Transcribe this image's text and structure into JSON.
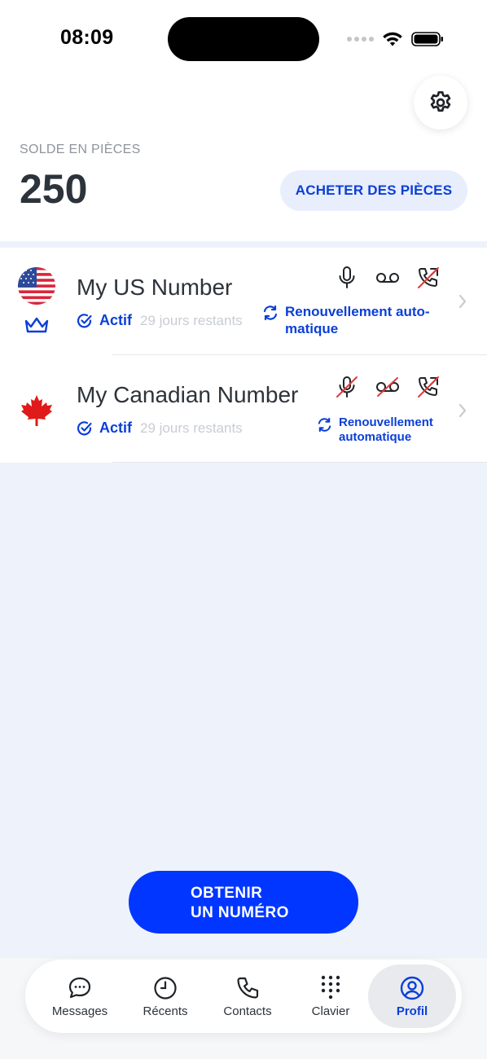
{
  "status_bar": {
    "time": "08:09"
  },
  "balance": {
    "label": "SOLDE EN PIÈCES",
    "value": "250",
    "buy_label": "ACHETER DES PIÈCES"
  },
  "numbers": [
    {
      "name": "My US Number",
      "flag": "us-flag-icon",
      "premium_icon": "crown-icon",
      "status": "Actif",
      "days_left": "29 jours restants",
      "features": {
        "recording": true,
        "voicemail": true,
        "call_forwarding": false
      },
      "renewal": "Renouvellement auto-\nmatique"
    },
    {
      "name": "My Canadian Number",
      "flag": "canada-flag-icon",
      "status": "Actif",
      "days_left": "29 jours restants",
      "features": {
        "recording": false,
        "voicemail": false,
        "call_forwarding": false
      },
      "renewal": "Renouvellement\nautomatique"
    }
  ],
  "cta": {
    "label": "OBTENIR\nUN NUMÉRO"
  },
  "tabs": [
    {
      "label": "Messages",
      "icon": "chat-bubble-icon",
      "active": false
    },
    {
      "label": "Récents",
      "icon": "clock-icon",
      "active": false
    },
    {
      "label": "Contacts",
      "icon": "phone-icon",
      "active": false
    },
    {
      "label": "Clavier",
      "icon": "keypad-icon",
      "active": false
    },
    {
      "label": "Profil",
      "icon": "profile-icon",
      "active": true
    }
  ],
  "colors": {
    "accent": "#0a3fd8",
    "cta": "#0036ff",
    "background": "#eef2fb",
    "disabled_strike": "#e03a3a"
  }
}
